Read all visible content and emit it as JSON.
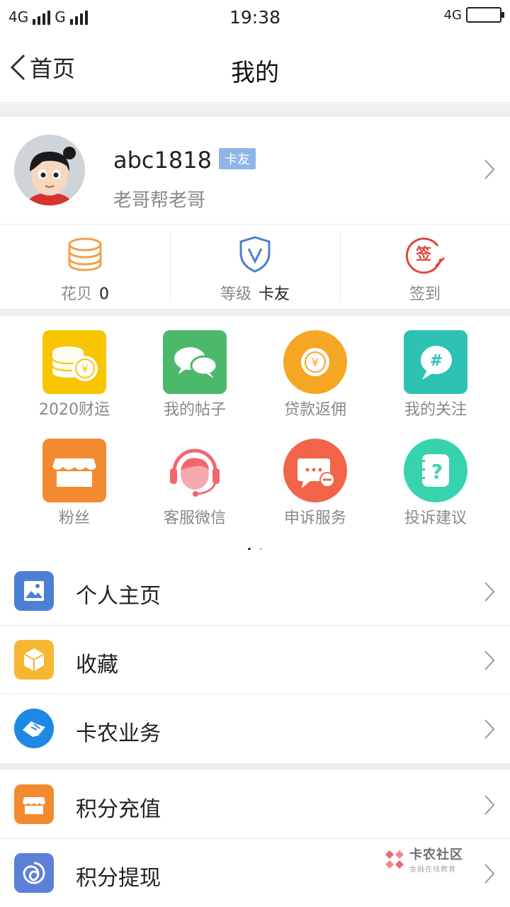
{
  "status_bar": {
    "left_network_1": "4G",
    "left_network_2": "G",
    "time": "19:38",
    "right_network": "4G"
  },
  "navbar": {
    "back_label": "首页",
    "title": "我的"
  },
  "profile": {
    "username": "abc1818",
    "badge": "卡友",
    "subtitle": "老哥帮老哥"
  },
  "stats": [
    {
      "label": "花贝",
      "value": "0",
      "icon": "coins-icon"
    },
    {
      "label": "等级",
      "value": "卡友",
      "icon": "shield-v-icon"
    },
    {
      "label": "签到",
      "value": "",
      "icon": "sign-in-icon"
    }
  ],
  "grid": [
    {
      "label": "2020财运",
      "icon": "coin-stack-icon",
      "color": "#F7C600"
    },
    {
      "label": "我的帖子",
      "icon": "chat-bubbles-icon",
      "color": "#4CB86A"
    },
    {
      "label": "贷款返佣",
      "icon": "yen-coin-icon",
      "color": "#F5A623"
    },
    {
      "label": "我的关注",
      "icon": "hashtag-icon",
      "color": "#2EC2B3"
    },
    {
      "label": "粉丝",
      "icon": "storefront-icon",
      "color": "#F28A30"
    },
    {
      "label": "客服微信",
      "icon": "headset-agent-icon",
      "color": "#F0686E"
    },
    {
      "label": "申诉服务",
      "icon": "message-minus-icon",
      "color": "#F2644A"
    },
    {
      "label": "投诉建议",
      "icon": "question-notebook-icon",
      "color": "#36D3AE"
    }
  ],
  "pager": {
    "active": 0,
    "count": 2
  },
  "list": [
    {
      "label": "个人主页",
      "icon": "picture-icon",
      "color": "#4E7FD6"
    },
    {
      "label": "收藏",
      "icon": "box-icon",
      "color": "#F7B733"
    },
    {
      "label": "卡农业务",
      "icon": "handshake-icon",
      "color": "#1E88E5"
    },
    {
      "label": "积分充值",
      "icon": "shop-icon",
      "color": "#F28A30"
    },
    {
      "label": "积分提现",
      "icon": "swirl-icon",
      "color": "#5C7FD8"
    }
  ],
  "watermark": {
    "title": "卡农社区",
    "subtitle": "金融在线教育"
  }
}
